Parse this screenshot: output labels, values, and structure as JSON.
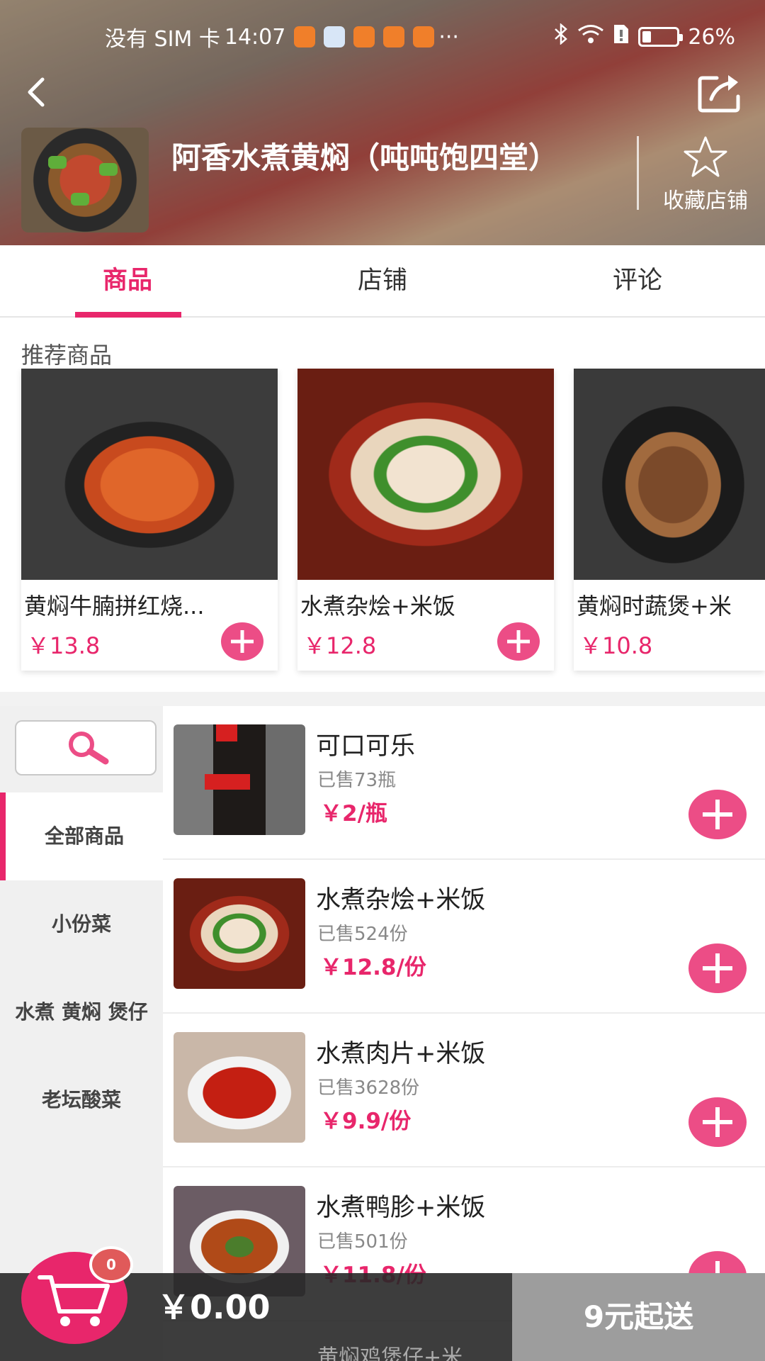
{
  "status_bar": {
    "carrier": "没有 SIM 卡",
    "time": "14:07",
    "more": "···",
    "battery": "26%",
    "battery_level": 0.26
  },
  "shop": {
    "name": "阿香水煮黄焖（吨吨饱四堂）",
    "favorite_label": "收藏店铺"
  },
  "tabs": [
    {
      "label": "商品",
      "active": true
    },
    {
      "label": "店铺",
      "active": false
    },
    {
      "label": "评论",
      "active": false
    }
  ],
  "recommended": {
    "title": "推荐商品",
    "items": [
      {
        "name": "黄焖牛腩拼红烧...",
        "price": "￥13.8"
      },
      {
        "name": "水煮杂烩+米饭",
        "price": "￥12.8"
      },
      {
        "name": "黄焖时蔬煲+米",
        "price": "￥10.8"
      }
    ]
  },
  "categories": [
    {
      "label": "全部商品",
      "active": true
    },
    {
      "label": "小份菜",
      "active": false
    },
    {
      "label": "水煮 黄焖 煲仔",
      "active": false
    },
    {
      "label": "老坛酸菜",
      "active": false
    }
  ],
  "products": [
    {
      "name": "可口可乐",
      "sold": "已售73瓶",
      "price": "￥2/瓶"
    },
    {
      "name": "水煮杂烩+米饭",
      "sold": "已售524份",
      "price": "￥12.8/份"
    },
    {
      "name": "水煮肉片+米饭",
      "sold": "已售3628份",
      "price": "￥9.9/份"
    },
    {
      "name": "水煮鸭胗+米饭",
      "sold": "已售501份",
      "price": "￥11.8/份"
    }
  ],
  "next_product_peek": "黄焖鸡煲仔+米",
  "cart": {
    "count": "0",
    "total": "￥0.00",
    "min_order": "9元起送"
  },
  "colors": {
    "accent": "#e8266b",
    "checkout_disabled": "#9d9d9d"
  }
}
